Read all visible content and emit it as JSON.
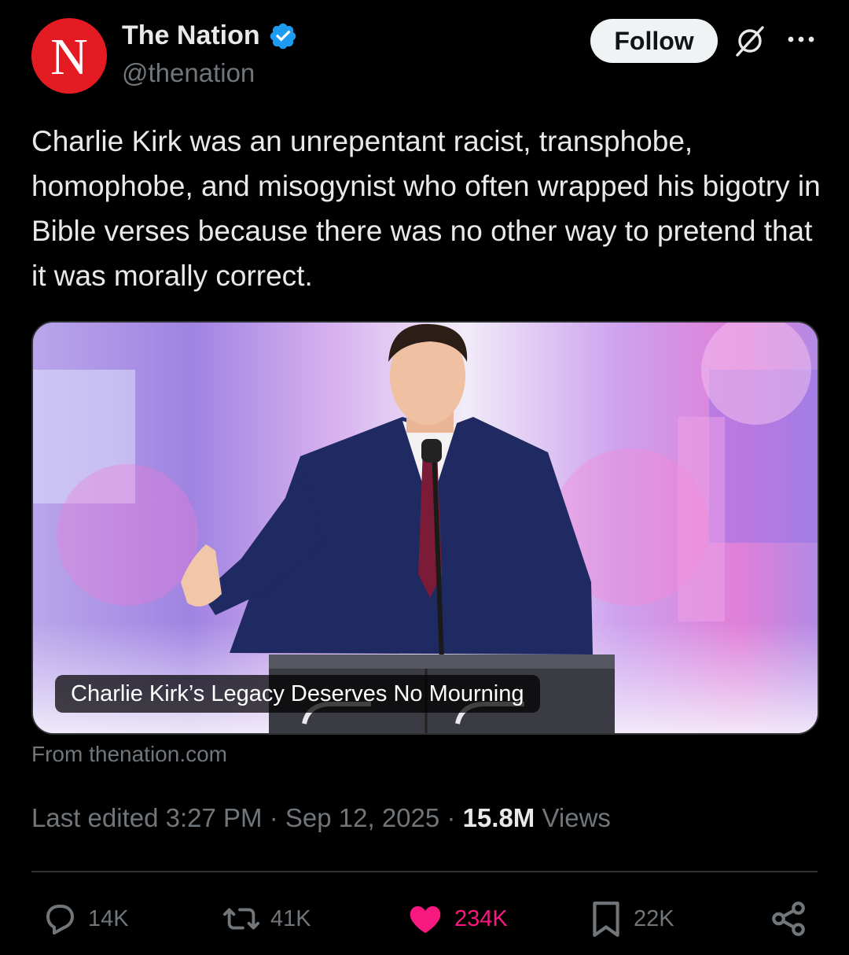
{
  "author": {
    "avatar_letter": "N",
    "display_name": "The Nation",
    "handle": "@thenation",
    "verified": true,
    "verified_color": "#1d9bf0",
    "avatar_color": "#e51b23"
  },
  "header": {
    "follow_label": "Follow",
    "grok_icon": "grok-icon",
    "more_icon": "more-icon"
  },
  "tweet": {
    "text": "Charlie Kirk was an unrepentant racist, transphobe, homophobe, and misogynist who often wrapped his bigotry in Bible verses because there was no other way to pretend that it was morally correct."
  },
  "card": {
    "caption": "Charlie Kirk’s Legacy Deserves No Mourning",
    "source": "From thenation.com"
  },
  "meta": {
    "edited_prefix": "Last edited",
    "time": "3:27 PM",
    "separator": "·",
    "date": "Sep 12, 2025",
    "views_count": "15.8M",
    "views_label": "Views"
  },
  "actions": {
    "replies": "14K",
    "reposts": "41K",
    "likes": "234K",
    "bookmarks": "22K",
    "like_color": "#f91880"
  }
}
